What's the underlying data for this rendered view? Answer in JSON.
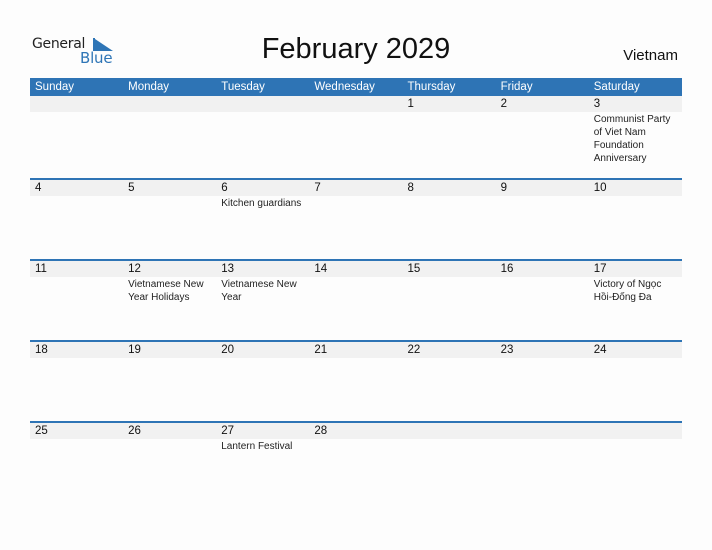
{
  "logo": {
    "word1": "General",
    "word2": "Blue"
  },
  "title": "February 2029",
  "country": "Vietnam",
  "colors": {
    "accent": "#2e74b5",
    "date_strip": "#f1f1f1"
  },
  "weekdays": [
    "Sunday",
    "Monday",
    "Tuesday",
    "Wednesday",
    "Thursday",
    "Friday",
    "Saturday"
  ],
  "weeks": [
    {
      "days": [
        {
          "num": "",
          "event": ""
        },
        {
          "num": "",
          "event": ""
        },
        {
          "num": "",
          "event": ""
        },
        {
          "num": "",
          "event": ""
        },
        {
          "num": "1",
          "event": ""
        },
        {
          "num": "2",
          "event": ""
        },
        {
          "num": "3",
          "event": "Communist Party of Viet Nam Foundation Anniversary"
        }
      ]
    },
    {
      "days": [
        {
          "num": "4",
          "event": ""
        },
        {
          "num": "5",
          "event": ""
        },
        {
          "num": "6",
          "event": "Kitchen guardians"
        },
        {
          "num": "7",
          "event": ""
        },
        {
          "num": "8",
          "event": ""
        },
        {
          "num": "9",
          "event": ""
        },
        {
          "num": "10",
          "event": ""
        }
      ]
    },
    {
      "days": [
        {
          "num": "11",
          "event": ""
        },
        {
          "num": "12",
          "event": "Vietnamese New Year Holidays"
        },
        {
          "num": "13",
          "event": "Vietnamese New Year"
        },
        {
          "num": "14",
          "event": ""
        },
        {
          "num": "15",
          "event": ""
        },
        {
          "num": "16",
          "event": ""
        },
        {
          "num": "17",
          "event": "Victory of Ngọc Hồi-Đống Đa"
        }
      ]
    },
    {
      "days": [
        {
          "num": "18",
          "event": ""
        },
        {
          "num": "19",
          "event": ""
        },
        {
          "num": "20",
          "event": ""
        },
        {
          "num": "21",
          "event": ""
        },
        {
          "num": "22",
          "event": ""
        },
        {
          "num": "23",
          "event": ""
        },
        {
          "num": "24",
          "event": ""
        }
      ]
    },
    {
      "days": [
        {
          "num": "25",
          "event": ""
        },
        {
          "num": "26",
          "event": ""
        },
        {
          "num": "27",
          "event": "Lantern Festival"
        },
        {
          "num": "28",
          "event": ""
        },
        {
          "num": "",
          "event": ""
        },
        {
          "num": "",
          "event": ""
        },
        {
          "num": "",
          "event": ""
        }
      ]
    }
  ]
}
